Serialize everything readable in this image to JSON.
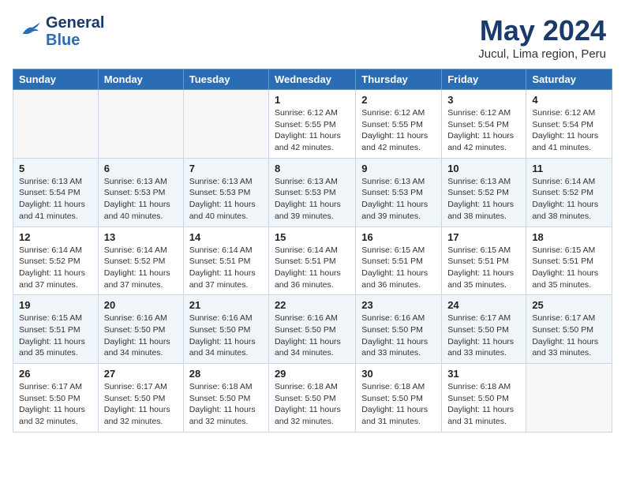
{
  "header": {
    "logo_general": "General",
    "logo_blue": "Blue",
    "month": "May 2024",
    "location": "Jucul, Lima region, Peru"
  },
  "weekdays": [
    "Sunday",
    "Monday",
    "Tuesday",
    "Wednesday",
    "Thursday",
    "Friday",
    "Saturday"
  ],
  "weeks": [
    [
      {
        "day": "",
        "info": ""
      },
      {
        "day": "",
        "info": ""
      },
      {
        "day": "",
        "info": ""
      },
      {
        "day": "1",
        "info": "Sunrise: 6:12 AM\nSunset: 5:55 PM\nDaylight: 11 hours\nand 42 minutes."
      },
      {
        "day": "2",
        "info": "Sunrise: 6:12 AM\nSunset: 5:55 PM\nDaylight: 11 hours\nand 42 minutes."
      },
      {
        "day": "3",
        "info": "Sunrise: 6:12 AM\nSunset: 5:54 PM\nDaylight: 11 hours\nand 42 minutes."
      },
      {
        "day": "4",
        "info": "Sunrise: 6:12 AM\nSunset: 5:54 PM\nDaylight: 11 hours\nand 41 minutes."
      }
    ],
    [
      {
        "day": "5",
        "info": "Sunrise: 6:13 AM\nSunset: 5:54 PM\nDaylight: 11 hours\nand 41 minutes."
      },
      {
        "day": "6",
        "info": "Sunrise: 6:13 AM\nSunset: 5:53 PM\nDaylight: 11 hours\nand 40 minutes."
      },
      {
        "day": "7",
        "info": "Sunrise: 6:13 AM\nSunset: 5:53 PM\nDaylight: 11 hours\nand 40 minutes."
      },
      {
        "day": "8",
        "info": "Sunrise: 6:13 AM\nSunset: 5:53 PM\nDaylight: 11 hours\nand 39 minutes."
      },
      {
        "day": "9",
        "info": "Sunrise: 6:13 AM\nSunset: 5:53 PM\nDaylight: 11 hours\nand 39 minutes."
      },
      {
        "day": "10",
        "info": "Sunrise: 6:13 AM\nSunset: 5:52 PM\nDaylight: 11 hours\nand 38 minutes."
      },
      {
        "day": "11",
        "info": "Sunrise: 6:14 AM\nSunset: 5:52 PM\nDaylight: 11 hours\nand 38 minutes."
      }
    ],
    [
      {
        "day": "12",
        "info": "Sunrise: 6:14 AM\nSunset: 5:52 PM\nDaylight: 11 hours\nand 37 minutes."
      },
      {
        "day": "13",
        "info": "Sunrise: 6:14 AM\nSunset: 5:52 PM\nDaylight: 11 hours\nand 37 minutes."
      },
      {
        "day": "14",
        "info": "Sunrise: 6:14 AM\nSunset: 5:51 PM\nDaylight: 11 hours\nand 37 minutes."
      },
      {
        "day": "15",
        "info": "Sunrise: 6:14 AM\nSunset: 5:51 PM\nDaylight: 11 hours\nand 36 minutes."
      },
      {
        "day": "16",
        "info": "Sunrise: 6:15 AM\nSunset: 5:51 PM\nDaylight: 11 hours\nand 36 minutes."
      },
      {
        "day": "17",
        "info": "Sunrise: 6:15 AM\nSunset: 5:51 PM\nDaylight: 11 hours\nand 35 minutes."
      },
      {
        "day": "18",
        "info": "Sunrise: 6:15 AM\nSunset: 5:51 PM\nDaylight: 11 hours\nand 35 minutes."
      }
    ],
    [
      {
        "day": "19",
        "info": "Sunrise: 6:15 AM\nSunset: 5:51 PM\nDaylight: 11 hours\nand 35 minutes."
      },
      {
        "day": "20",
        "info": "Sunrise: 6:16 AM\nSunset: 5:50 PM\nDaylight: 11 hours\nand 34 minutes."
      },
      {
        "day": "21",
        "info": "Sunrise: 6:16 AM\nSunset: 5:50 PM\nDaylight: 11 hours\nand 34 minutes."
      },
      {
        "day": "22",
        "info": "Sunrise: 6:16 AM\nSunset: 5:50 PM\nDaylight: 11 hours\nand 34 minutes."
      },
      {
        "day": "23",
        "info": "Sunrise: 6:16 AM\nSunset: 5:50 PM\nDaylight: 11 hours\nand 33 minutes."
      },
      {
        "day": "24",
        "info": "Sunrise: 6:17 AM\nSunset: 5:50 PM\nDaylight: 11 hours\nand 33 minutes."
      },
      {
        "day": "25",
        "info": "Sunrise: 6:17 AM\nSunset: 5:50 PM\nDaylight: 11 hours\nand 33 minutes."
      }
    ],
    [
      {
        "day": "26",
        "info": "Sunrise: 6:17 AM\nSunset: 5:50 PM\nDaylight: 11 hours\nand 32 minutes."
      },
      {
        "day": "27",
        "info": "Sunrise: 6:17 AM\nSunset: 5:50 PM\nDaylight: 11 hours\nand 32 minutes."
      },
      {
        "day": "28",
        "info": "Sunrise: 6:18 AM\nSunset: 5:50 PM\nDaylight: 11 hours\nand 32 minutes."
      },
      {
        "day": "29",
        "info": "Sunrise: 6:18 AM\nSunset: 5:50 PM\nDaylight: 11 hours\nand 32 minutes."
      },
      {
        "day": "30",
        "info": "Sunrise: 6:18 AM\nSunset: 5:50 PM\nDaylight: 11 hours\nand 31 minutes."
      },
      {
        "day": "31",
        "info": "Sunrise: 6:18 AM\nSunset: 5:50 PM\nDaylight: 11 hours\nand 31 minutes."
      },
      {
        "day": "",
        "info": ""
      }
    ]
  ]
}
